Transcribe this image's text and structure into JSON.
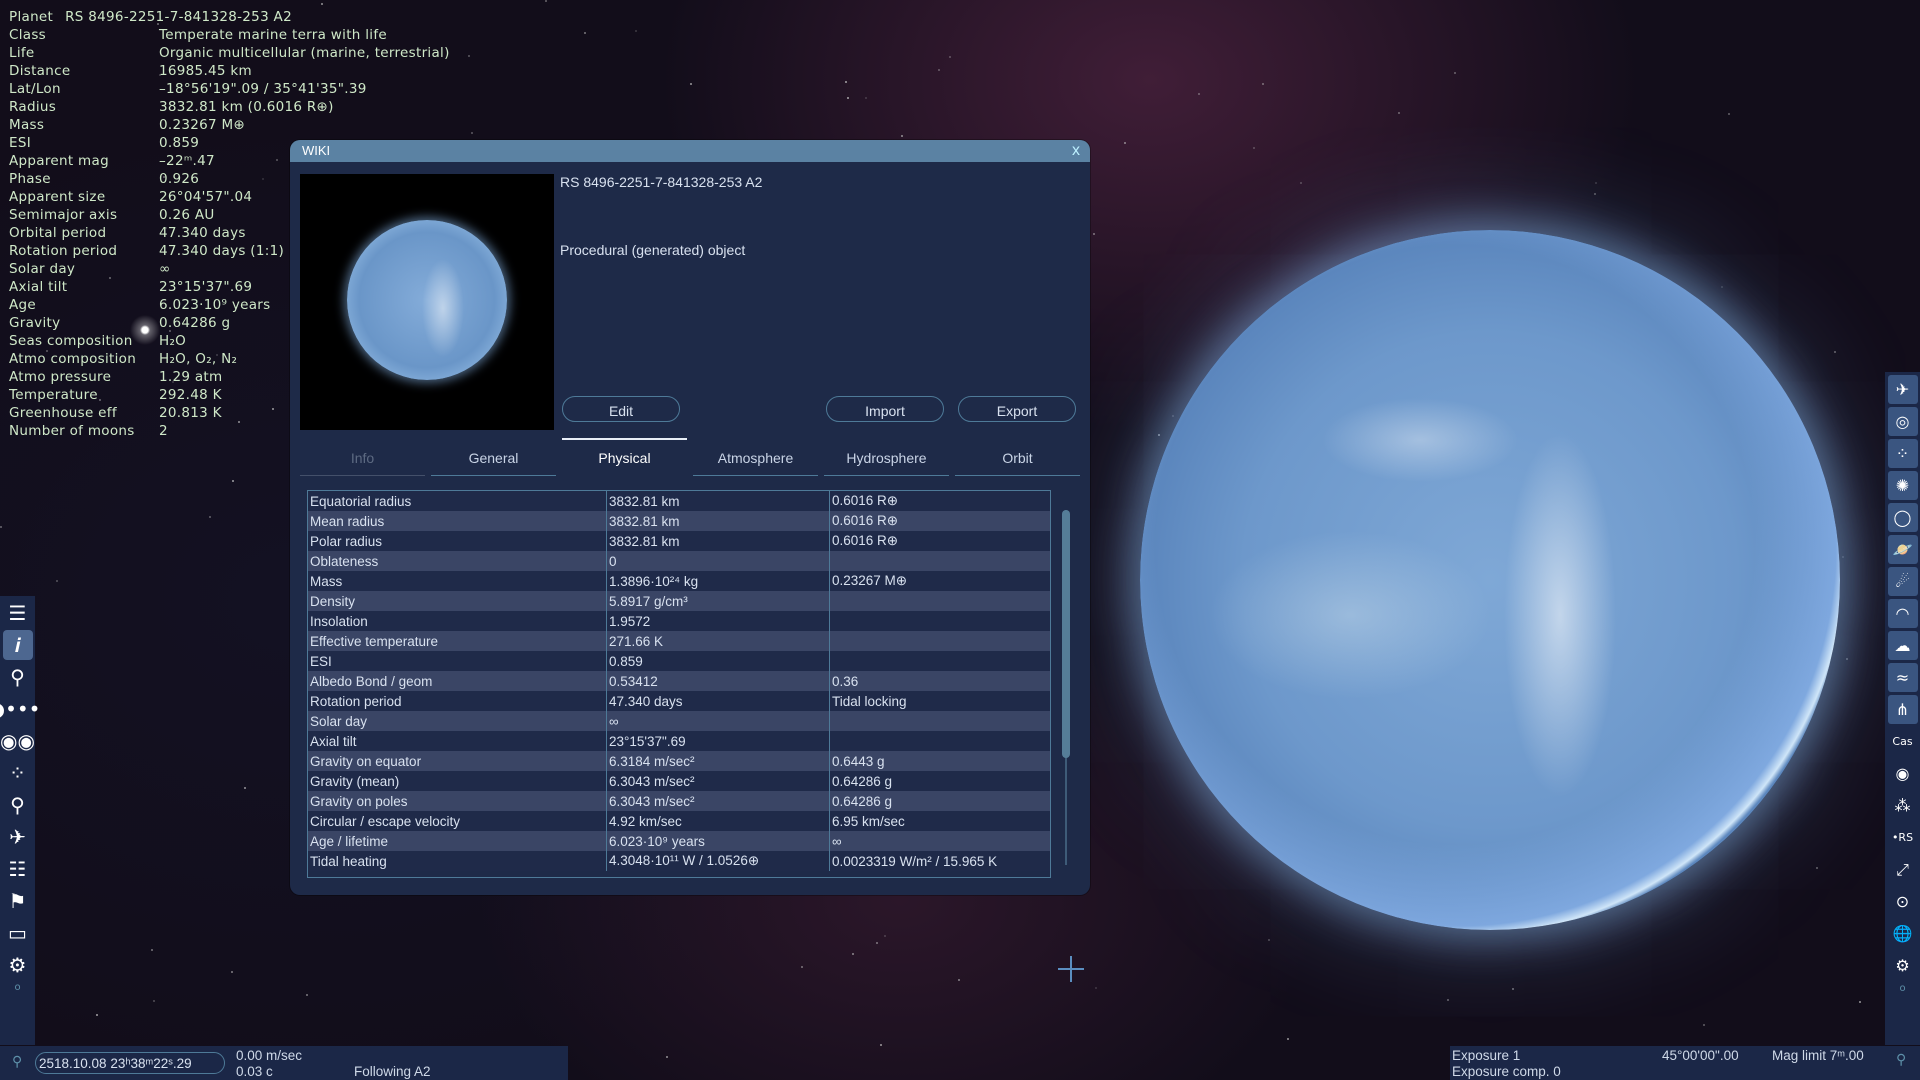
{
  "hud": {
    "title_label": "Planet",
    "title_value": "RS 8496-2251-7-841328-253 A2",
    "rows": [
      {
        "k": "Class",
        "v": "Temperate marine terra with life"
      },
      {
        "k": "Life",
        "v": "Organic multicellular (marine, terrestrial)"
      },
      {
        "k": "Distance",
        "v": "16985.45 km"
      },
      {
        "k": "Lat/Lon",
        "v": "–18°56'19\".09 / 35°41'35\".39"
      },
      {
        "k": "Radius",
        "v": "3832.81 km (0.6016 R⊕)"
      },
      {
        "k": "Mass",
        "v": "0.23267 M⊕"
      },
      {
        "k": "ESI",
        "v": "0.859"
      },
      {
        "k": "Apparent mag",
        "v": "–22ᵐ.47"
      },
      {
        "k": "Phase",
        "v": "0.926"
      },
      {
        "k": "Apparent size",
        "v": "26°04'57\".04"
      },
      {
        "k": "Semimajor axis",
        "v": "0.26 AU"
      },
      {
        "k": "Orbital period",
        "v": "47.340 days"
      },
      {
        "k": "Rotation period",
        "v": "47.340 days (1:1)"
      },
      {
        "k": "Solar day",
        "v": "∞"
      },
      {
        "k": "Axial tilt",
        "v": "23°15'37\".69"
      },
      {
        "k": "Age",
        "v": "6.023·10⁹ years"
      },
      {
        "k": "Gravity",
        "v": "0.64286 g"
      },
      {
        "k": "Seas composition",
        "v": "H₂O"
      },
      {
        "k": "Atmo composition",
        "v": "H₂O, O₂, N₂"
      },
      {
        "k": "Atmo pressure",
        "v": "1.29 atm"
      },
      {
        "k": "Temperature",
        "v": "292.48 K"
      },
      {
        "k": "Greenhouse eff",
        "v": "20.813 K"
      },
      {
        "k": "Number of moons",
        "v": "2"
      }
    ]
  },
  "wiki": {
    "title": "WIKI",
    "close_label": "x",
    "object_name": "RS 8496-2251-7-841328-253 A2",
    "description": "Procedural (generated) object",
    "buttons": {
      "edit": "Edit",
      "import": "Import",
      "export": "Export"
    },
    "tabs": [
      {
        "label": "Info",
        "state": "disabled"
      },
      {
        "label": "General",
        "state": "normal"
      },
      {
        "label": "Physical",
        "state": "active"
      },
      {
        "label": "Atmosphere",
        "state": "normal"
      },
      {
        "label": "Hydrosphere",
        "state": "normal"
      },
      {
        "label": "Orbit",
        "state": "normal"
      }
    ],
    "table": [
      [
        "Equatorial radius",
        "3832.81 km",
        "0.6016 R⊕"
      ],
      [
        "Mean radius",
        "3832.81 km",
        "0.6016 R⊕"
      ],
      [
        "Polar radius",
        "3832.81 km",
        "0.6016 R⊕"
      ],
      [
        "Oblateness",
        "0",
        ""
      ],
      [
        "Mass",
        "1.3896·10²⁴ kg",
        "0.23267 M⊕"
      ],
      [
        "Density",
        "5.8917 g/cm³",
        ""
      ],
      [
        "Insolation",
        "1.9572",
        ""
      ],
      [
        "Effective temperature",
        "271.66 K",
        ""
      ],
      [
        "ESI",
        "0.859",
        ""
      ],
      [
        "Albedo Bond / geom",
        "0.53412",
        "0.36"
      ],
      [
        "Rotation period",
        "47.340 days",
        "Tidal locking"
      ],
      [
        "Solar day",
        "∞",
        ""
      ],
      [
        "Axial tilt",
        "23°15'37\".69",
        ""
      ],
      [
        "Gravity on equator",
        "6.3184 m/sec²",
        "0.6443 g"
      ],
      [
        "Gravity (mean)",
        "6.3043 m/sec²",
        "0.64286 g"
      ],
      [
        "Gravity on poles",
        "6.3043 m/sec²",
        "0.64286 g"
      ],
      [
        "Circular / escape velocity",
        "4.92 km/sec",
        "6.95 km/sec"
      ],
      [
        "Age / lifetime",
        "6.023·10⁹ years",
        "∞"
      ],
      [
        "Tidal heating",
        "4.3048·10¹¹ W / 1.0526⊕",
        "0.0023319 W/m² / 15.965 K"
      ]
    ],
    "scroll_fraction_visible": 0.7
  },
  "left_toolbar": [
    {
      "name": "menu-icon",
      "glyph": "☰",
      "active": false
    },
    {
      "name": "info-icon",
      "glyph": "𝒊",
      "active": true
    },
    {
      "name": "planetarium-icon",
      "glyph": "⚲",
      "active": false
    },
    {
      "name": "solar-system-icon",
      "glyph": "◗•••",
      "active": false
    },
    {
      "name": "observatory-icon",
      "glyph": "◉◉",
      "active": false
    },
    {
      "name": "star-field-icon",
      "glyph": "⁘",
      "active": false
    },
    {
      "name": "search-icon",
      "glyph": "⚲",
      "active": false
    },
    {
      "name": "spaceship-icon",
      "glyph": "✈",
      "active": false
    },
    {
      "name": "notepad-icon",
      "glyph": "☷",
      "active": false
    },
    {
      "name": "flag-icon",
      "glyph": "⚑",
      "active": false
    },
    {
      "name": "monitor-icon",
      "glyph": "▭",
      "active": false
    },
    {
      "name": "settings-icon",
      "glyph": "⚙",
      "active": false
    }
  ],
  "right_toolbar": [
    {
      "name": "spaceships-filter-icon",
      "glyph": "✈",
      "boxed": true
    },
    {
      "name": "galaxies-filter-icon",
      "glyph": "◎",
      "boxed": true
    },
    {
      "name": "stars-filter-icon",
      "glyph": "⁘",
      "boxed": true
    },
    {
      "name": "star-clusters-filter-icon",
      "glyph": "✺",
      "boxed": true
    },
    {
      "name": "nebulae-filter-icon",
      "glyph": "◯",
      "boxed": true
    },
    {
      "name": "planets-filter-icon",
      "glyph": "🪐",
      "boxed": true
    },
    {
      "name": "comets-filter-icon",
      "glyph": "☄",
      "boxed": true
    },
    {
      "name": "atmosphere-filter-icon",
      "glyph": "◠",
      "boxed": true
    },
    {
      "name": "clouds-filter-icon",
      "glyph": "☁",
      "boxed": true
    },
    {
      "name": "water-filter-icon",
      "glyph": "≈",
      "boxed": true
    },
    {
      "name": "aurora-filter-icon",
      "glyph": "⋔",
      "boxed": true
    },
    {
      "name": "constellations-icon",
      "glyph": "Cas",
      "boxed": false
    },
    {
      "name": "orbits-icon",
      "glyph": "◉",
      "boxed": false
    },
    {
      "name": "star-markers-icon",
      "glyph": "⁂",
      "boxed": false
    },
    {
      "name": "labels-icon",
      "glyph": "•RS",
      "boxed": false
    },
    {
      "name": "fullscreen-icon",
      "glyph": "⤢",
      "boxed": false
    },
    {
      "name": "target-icon",
      "glyph": "⊙",
      "boxed": false
    },
    {
      "name": "grid-icon",
      "glyph": "🌐",
      "boxed": false
    },
    {
      "name": "settings-icon",
      "glyph": "⚙",
      "boxed": false
    }
  ],
  "bottom": {
    "datetime": "2518.10.08 23ʰ38ᵐ22ˢ.29",
    "velocity": "0.00 m/sec",
    "velocity_c": "0.03 c",
    "following": "Following A2",
    "exposure": "Exposure 1",
    "exposure_comp": "Exposure comp. 0",
    "fov": "45°00'00\".00",
    "mag_limit": "Mag limit 7ᵐ.00"
  }
}
